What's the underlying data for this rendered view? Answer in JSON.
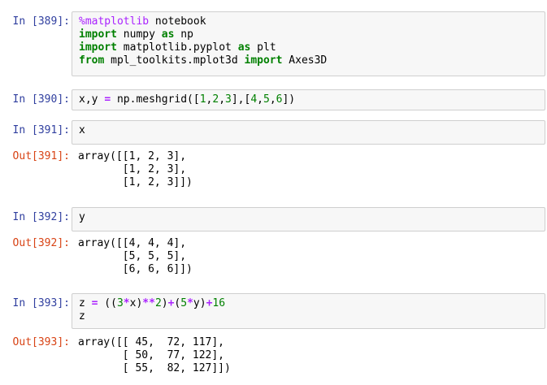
{
  "cells": [
    {
      "in_prompt": "In [389]:",
      "code": [
        {
          "tokens": [
            [
              "mg",
              "%matplotlib"
            ],
            [
              "t",
              " notebook"
            ]
          ]
        },
        {
          "tokens": [
            [
              "kw",
              "import"
            ],
            [
              "t",
              " numpy "
            ],
            [
              "kw",
              "as"
            ],
            [
              "t",
              " np"
            ]
          ]
        },
        {
          "tokens": [
            [
              "kw",
              "import"
            ],
            [
              "t",
              " matplotlib.pyplot "
            ],
            [
              "kw",
              "as"
            ],
            [
              "t",
              " plt"
            ]
          ]
        },
        {
          "tokens": [
            [
              "kw",
              "from"
            ],
            [
              "t",
              " mpl_toolkits.mplot3d "
            ],
            [
              "kw",
              "import"
            ],
            [
              "t",
              " Axes3D"
            ]
          ]
        }
      ]
    },
    {
      "in_prompt": "In [390]:",
      "code": [
        {
          "tokens": [
            [
              "t",
              "x,y "
            ],
            [
              "op",
              "="
            ],
            [
              "t",
              " np.meshgrid(["
            ],
            [
              "num",
              "1"
            ],
            [
              "t",
              ","
            ],
            [
              "num",
              "2"
            ],
            [
              "t",
              ","
            ],
            [
              "num",
              "3"
            ],
            [
              "t",
              "],["
            ],
            [
              "num",
              "4"
            ],
            [
              "t",
              ","
            ],
            [
              "num",
              "5"
            ],
            [
              "t",
              ","
            ],
            [
              "num",
              "6"
            ],
            [
              "t",
              "])"
            ]
          ]
        }
      ]
    },
    {
      "in_prompt": "In [391]:",
      "code": [
        {
          "tokens": [
            [
              "t",
              "x"
            ]
          ]
        }
      ],
      "out_prompt": "Out[391]:",
      "output": [
        "array([[1, 2, 3],",
        "       [1, 2, 3],",
        "       [1, 2, 3]])"
      ]
    },
    {
      "in_prompt": "In [392]:",
      "code": [
        {
          "tokens": [
            [
              "t",
              "y"
            ]
          ]
        }
      ],
      "out_prompt": "Out[392]:",
      "output": [
        "array([[4, 4, 4],",
        "       [5, 5, 5],",
        "       [6, 6, 6]])"
      ]
    },
    {
      "in_prompt": "In [393]:",
      "code": [
        {
          "tokens": [
            [
              "t",
              "z "
            ],
            [
              "op",
              "="
            ],
            [
              "t",
              " (("
            ],
            [
              "num",
              "3"
            ],
            [
              "op",
              "*"
            ],
            [
              "t",
              "x)"
            ],
            [
              "op",
              "**"
            ],
            [
              "num",
              "2"
            ],
            [
              "t",
              ")"
            ],
            [
              "op",
              "+"
            ],
            [
              "t",
              "("
            ],
            [
              "num",
              "5"
            ],
            [
              "op",
              "*"
            ],
            [
              "t",
              "y)"
            ],
            [
              "op",
              "+"
            ],
            [
              "num",
              "16"
            ]
          ]
        },
        {
          "tokens": [
            [
              "t",
              "z"
            ]
          ]
        }
      ],
      "out_prompt": "Out[393]:",
      "output": [
        "array([[ 45,  72, 117],",
        "       [ 50,  77, 122],",
        "       [ 55,  82, 127]])"
      ]
    }
  ]
}
